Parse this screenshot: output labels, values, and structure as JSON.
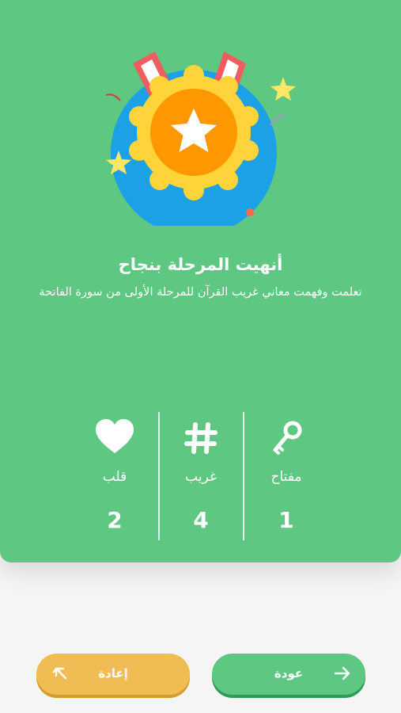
{
  "result": {
    "title": "أنهيت المرحلة بنجاح",
    "subtitle": "تعلمت وفهمت معاني غريب القرآن للمرحلة الأولى من سورة الفاتحة"
  },
  "stats": [
    {
      "icon": "heart-icon",
      "label": "قلب",
      "value": "2"
    },
    {
      "icon": "hashtag-icon",
      "label": "غريب",
      "value": "4"
    },
    {
      "icon": "key-icon",
      "label": "مفتاح",
      "value": "1"
    }
  ],
  "buttons": {
    "retry_label": "إعادة",
    "back_label": "عودة"
  },
  "colors": {
    "card": "#5ec882",
    "retry": "#f0bd54",
    "back": "#5ec882",
    "medal_ring": "#1da1e6",
    "medal_gold": "#ffd43b",
    "medal_orange": "#ff9800"
  }
}
